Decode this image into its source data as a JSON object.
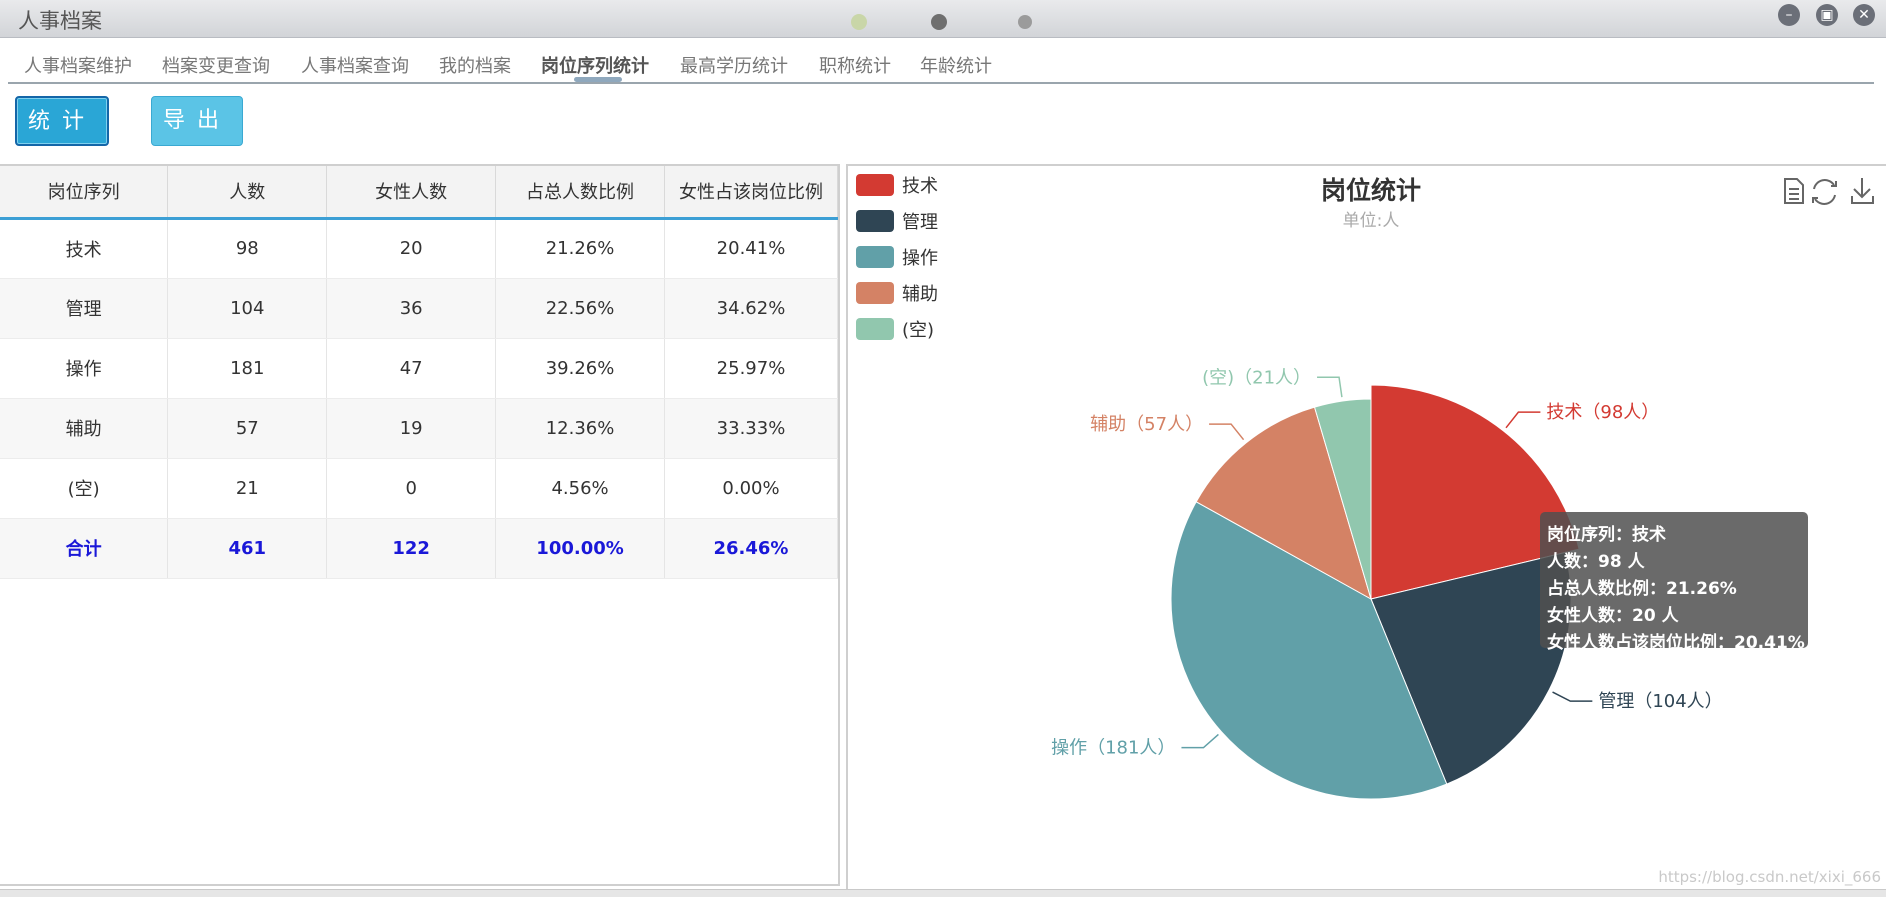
{
  "window": {
    "title": "人事档案"
  },
  "tabs": [
    {
      "label": "人事档案维护"
    },
    {
      "label": "档案变更查询"
    },
    {
      "label": "人事档案查询"
    },
    {
      "label": "我的档案"
    },
    {
      "label": "岗位序列统计",
      "active": true
    },
    {
      "label": "最高学历统计"
    },
    {
      "label": "职称统计"
    },
    {
      "label": "年龄统计"
    }
  ],
  "toolbar": {
    "stat_label": "统计",
    "export_label": "导出"
  },
  "table": {
    "headers": [
      "岗位序列",
      "人数",
      "女性人数",
      "占总人数比例",
      "女性占该岗位比例"
    ],
    "rows": [
      [
        "技术",
        "98",
        "20",
        "21.26%",
        "20.41%"
      ],
      [
        "管理",
        "104",
        "36",
        "22.56%",
        "34.62%"
      ],
      [
        "操作",
        "181",
        "47",
        "39.26%",
        "25.97%"
      ],
      [
        "辅助",
        "57",
        "19",
        "12.36%",
        "33.33%"
      ],
      [
        "(空)",
        "21",
        "0",
        "4.56%",
        "0.00%"
      ]
    ],
    "total": [
      "合计",
      "461",
      "122",
      "100.00%",
      "26.46%"
    ]
  },
  "chart_data": {
    "type": "pie",
    "title": "岗位统计",
    "subtitle": "单位:人",
    "legend_position": "top-left",
    "categories": [
      "技术",
      "管理",
      "操作",
      "辅助",
      "(空)"
    ],
    "values": [
      98,
      104,
      181,
      57,
      21
    ],
    "colors": [
      "#d33a32",
      "#2f4554",
      "#61a0a8",
      "#d48265",
      "#91c7ae"
    ],
    "slice_labels": [
      "技术（98人）",
      "管理（104人）",
      "操作（181人）",
      "辅助（57人）",
      "(空)（21人）"
    ]
  },
  "tooltip": {
    "lines": [
      "岗位序列：技术",
      "人数：98 人",
      "占总人数比例：21.26%",
      "女性人数：20 人",
      "女性人数占该岗位比例：20.41%"
    ]
  },
  "chart_tools": [
    "data-view-icon",
    "restore-icon",
    "save-image-icon"
  ],
  "watermark": "https://blog.csdn.net/xixi_666"
}
